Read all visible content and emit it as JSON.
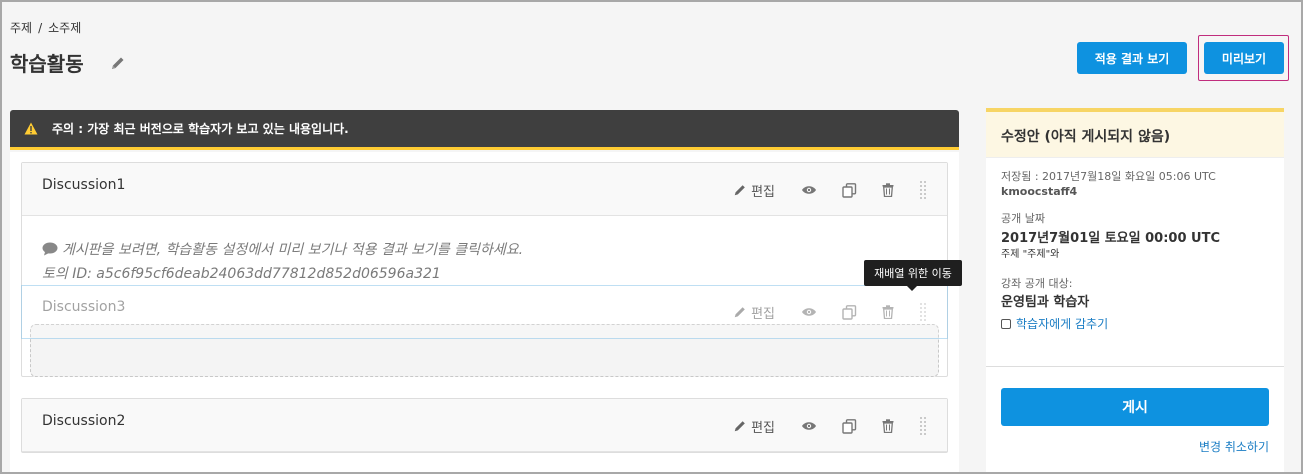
{
  "breadcrumb": {
    "section": "주제",
    "separator": "/",
    "subsection": "소주제"
  },
  "title": "학습활동",
  "buttons": {
    "view_live": "적용 결과 보기",
    "preview": "미리보기"
  },
  "warning": "주의 : 가장 최근 버전으로 학습자가 보고 있는 내용입니다.",
  "units": [
    {
      "name": "Discussion1",
      "edit_label": "편집",
      "message_line1": "게시판을 보려면, 학습활동 설정에서 미리 보기나 적용 결과 보기를 클릭하세요.",
      "message_line2": "토의 ID: a5c6f95cf6deab24063dd77812d852d06596a321"
    },
    {
      "name": "Discussion3",
      "edit_label": "편집"
    },
    {
      "name": "Discussion2",
      "edit_label": "편집"
    }
  ],
  "tooltip": "재배열 위한 이동",
  "sidebar": {
    "title": "수정안 (아직 게시되지 않음)",
    "saved_line": "저장됨 : 2017년7월18일 화요일 05:06 UTC",
    "saved_by": "kmoocstaff4",
    "release_label": "공개 날짜",
    "release_date": "2017년7월01일 토요일 00:00 UTC",
    "release_with": "주제 \"주제\"와",
    "visibility_label": "강좌 공개 대상:",
    "visibility_value": "운영팀과 학습자",
    "hide_label": "학습자에게 감추기",
    "publish": "게시",
    "discard": "변경 취소하기"
  },
  "colors": {
    "primary": "#0e92e0",
    "warning_bar": "#ffcc33",
    "preview_outline": "#c02d7d"
  }
}
